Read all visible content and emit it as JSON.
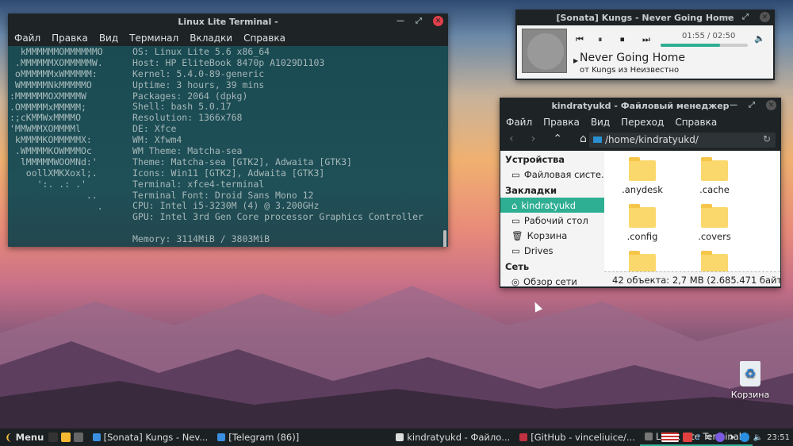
{
  "terminal": {
    "title": "Linux Lite Terminal -",
    "menu": [
      "Файл",
      "Правка",
      "Вид",
      "Терминал",
      "Вкладки",
      "Справка"
    ],
    "logo": [
      "  kMMMMMMOMMMMMMO",
      " .MMMMMMXOMMMMMW.",
      " oMMMMMMxWMMMMM:",
      " WMMMMMNkMMMMMO",
      ":MMMMMMOXMMMMW",
      ".OMMMMMxMMMMM;",
      ":;cKMMWxMMMMO",
      "'MMWMMXOMMMMl",
      " kMMMMKOMMMMMX:",
      " .WMMMMKOWMMMOc",
      "  lMMMMMWOOMNd:'",
      "   oollXMKXoxl;.",
      "     ':. .: .'",
      "              ..",
      "                ."
    ],
    "info": [
      "OS: Linux Lite 5.6 x86_64",
      "Host: HP EliteBook 8470p A1029D1103",
      "Kernel: 5.4.0-89-generic",
      "Uptime: 3 hours, 39 mins",
      "Packages: 2064 (dpkg)",
      "Shell: bash 5.0.17",
      "Resolution: 1366x768",
      "DE: Xfce",
      "WM: Xfwm4",
      "WM Theme: Matcha-sea",
      "Theme: Matcha-sea [GTK2], Adwaita [GTK3]",
      "Icons: Win11 [GTK2], Adwaita [GTK3]",
      "Terminal: xfce4-terminal",
      "Terminal Font: Droid Sans Mono 12",
      "CPU: Intel i5-3230M (4) @ 3.200GHz",
      "GPU: Intel 3rd Gen Core processor Graphics Controller",
      "",
      "Memory: 3114MiB / 3803MiB"
    ]
  },
  "sonata": {
    "title": "[Sonata] Kungs - Never Going Home",
    "time": "01:55 / 02:50",
    "progress": 0.68,
    "song": "Never Going Home",
    "artist": "от Kungs из Неизвестно"
  },
  "fm": {
    "title": "kindratyukd - Файловый менеджер",
    "menu": [
      "Файл",
      "Правка",
      "Вид",
      "Переход",
      "Справка"
    ],
    "path": "/home/kindratyukd/",
    "sections": {
      "devices": "Устройства",
      "bookmarks": "Закладки",
      "network": "Сеть"
    },
    "devices": [
      "Файловая систе..."
    ],
    "bookmarks": [
      "kindratyukd",
      "Рабочий стол",
      "Корзина",
      "Drives"
    ],
    "network": [
      "Обзор сети"
    ],
    "files": [
      ".anydesk",
      ".cache",
      ".config",
      ".covers",
      "",
      ""
    ],
    "status": "42 объекта: 2,7 MB (2.685.471 байт..."
  },
  "desktop": {
    "trash": "Корзина"
  },
  "taskbar": {
    "menu": "Menu",
    "items": [
      "[Sonata] Kungs - Nev...",
      "[Telegram (86)]",
      "kindratyukd - Файло...",
      "[GitHub - vinceliuice/...",
      "Linux Lite Terminal -"
    ],
    "clock": "23:51"
  },
  "colors": {
    "accent": "#2eae92"
  }
}
